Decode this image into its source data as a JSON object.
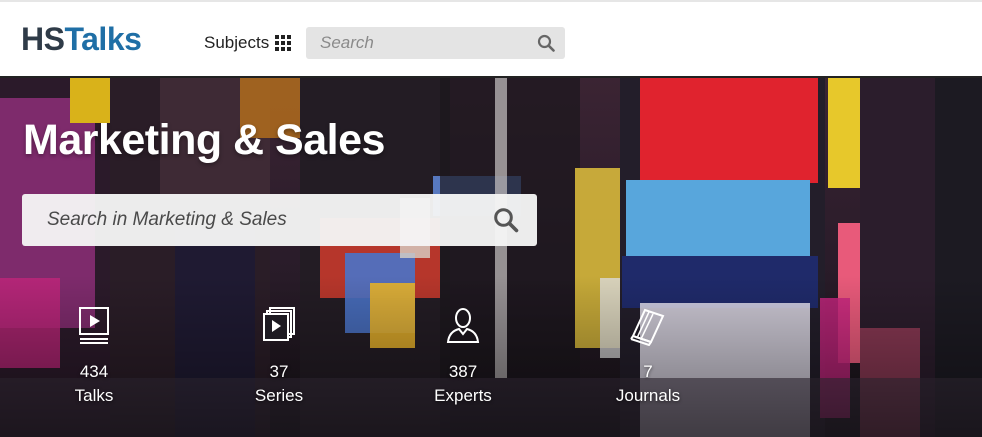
{
  "header": {
    "logo_part1": "HS",
    "logo_part2": "Talks",
    "subjects_label": "Subjects",
    "search_placeholder": "Search"
  },
  "hero": {
    "title": "Marketing & Sales",
    "search_placeholder": "Search in Marketing & Sales",
    "stats": [
      {
        "value": "434",
        "label": "Talks",
        "icon": "video-icon"
      },
      {
        "value": "37",
        "label": "Series",
        "icon": "series-icon"
      },
      {
        "value": "387",
        "label": "Experts",
        "icon": "user-icon"
      },
      {
        "value": "7",
        "label": "Journals",
        "icon": "book-icon"
      }
    ]
  },
  "colors": {
    "logo_dark": "#2f3b48",
    "logo_blue": "#1f6fa6",
    "search_bg": "#e4e4e4"
  }
}
